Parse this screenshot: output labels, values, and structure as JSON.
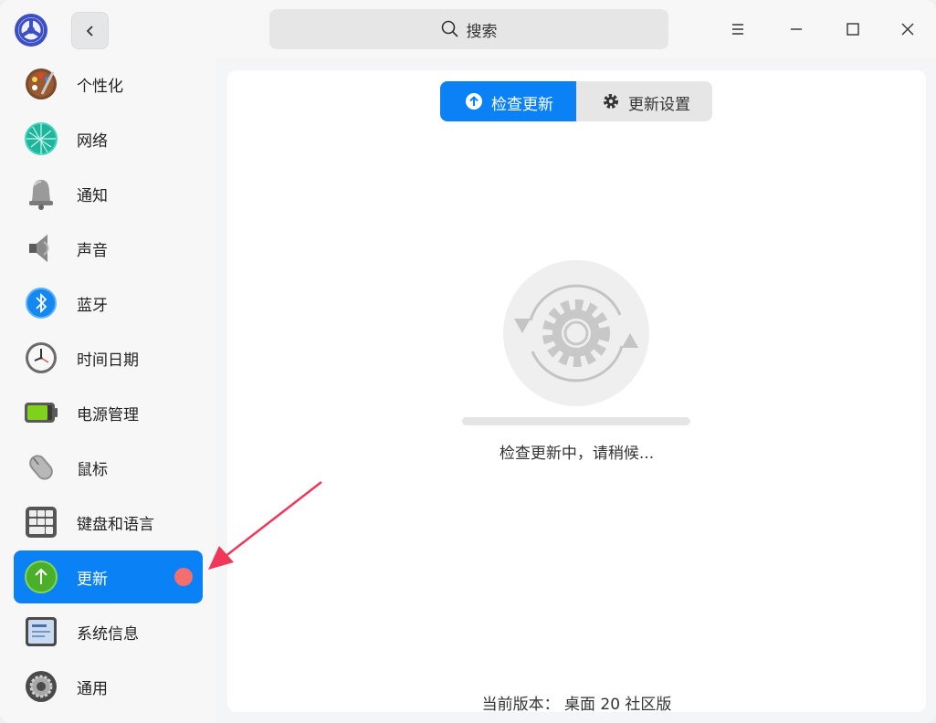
{
  "titlebar": {
    "search_placeholder": "搜索",
    "logo_icon": "control-center-logo-icon",
    "back_icon": "chevron-left-icon",
    "menu_icon": "menu-icon",
    "minimize_icon": "minimize-icon",
    "maximize_icon": "maximize-icon",
    "close_icon": "close-icon"
  },
  "sidebar": {
    "items": [
      {
        "label": "个性化",
        "icon": "palette-icon"
      },
      {
        "label": "网络",
        "icon": "network-globe-icon"
      },
      {
        "label": "通知",
        "icon": "bell-icon"
      },
      {
        "label": "声音",
        "icon": "speaker-icon"
      },
      {
        "label": "蓝牙",
        "icon": "bluetooth-icon"
      },
      {
        "label": "时间日期",
        "icon": "clock-icon"
      },
      {
        "label": "电源管理",
        "icon": "battery-icon"
      },
      {
        "label": "鼠标",
        "icon": "mouse-icon"
      },
      {
        "label": "键盘和语言",
        "icon": "keyboard-icon"
      },
      {
        "label": "更新",
        "icon": "update-arrow-icon",
        "active": true,
        "has_badge": true
      },
      {
        "label": "系统信息",
        "icon": "system-info-icon"
      },
      {
        "label": "通用",
        "icon": "general-gear-icon"
      }
    ],
    "accent_color": "#0a81f5",
    "badge_color": "#f36f6f"
  },
  "main": {
    "tabs": [
      {
        "label": "检查更新",
        "icon": "arrow-up-circle-icon",
        "active": true
      },
      {
        "label": "更新设置",
        "icon": "gear-icon",
        "active": false
      }
    ],
    "status_text": "检查更新中，请稍候...",
    "version_text": "当前版本：  桌面 20 社区版"
  }
}
